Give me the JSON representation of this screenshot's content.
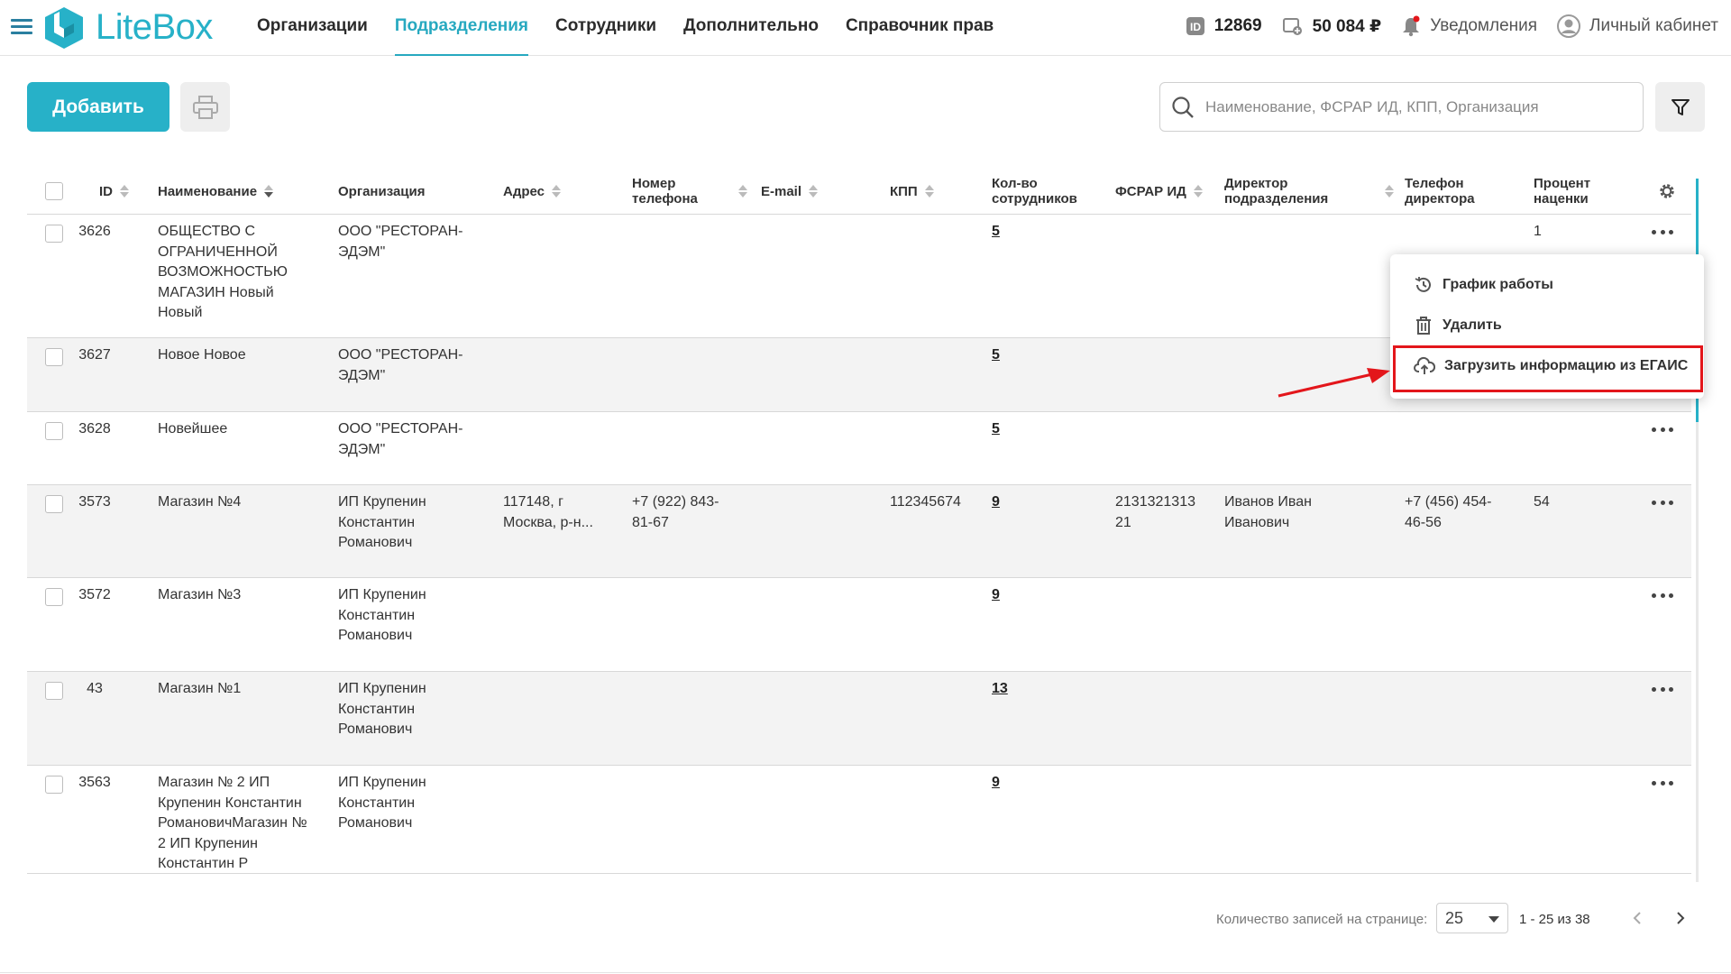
{
  "header": {
    "logo_text": "LiteBox",
    "nav": [
      "Организации",
      "Подразделения",
      "Сотрудники",
      "Дополнительно",
      "Справочник прав"
    ],
    "active_nav": "Подразделения",
    "id_value": "12869",
    "balance": "50 084 ₽",
    "notifications_label": "Уведомления",
    "account_label": "Личный кабинет"
  },
  "toolbar": {
    "add_label": "Добавить",
    "search_placeholder": "Наименование, ФСРАР ИД, КПП, Организация"
  },
  "table": {
    "columns": [
      "ID",
      "Наименование",
      "Организация",
      "Адрес",
      "Номер телефона",
      "E-mail",
      "КПП",
      "Кол-во сотрудников",
      "ФСРАР ИД",
      "Директор подразделения",
      "Телефон директора",
      "Процент наценки"
    ],
    "rows": [
      {
        "id": "3626",
        "name": [
          "ОБЩЕСТВО С",
          "ОГРАНИЧЕННОЙ",
          "ВОЗМОЖНОСТЬЮ",
          "МАГАЗИН Новый",
          "Новый"
        ],
        "org": [
          "ООО \"РЕСТОРАН-",
          "ЭДЭМ\""
        ],
        "address": [],
        "phone": [],
        "email": "",
        "kpp": "",
        "staff": "5",
        "fsrar": [],
        "director": [],
        "dir_phone": [],
        "markup": "1"
      },
      {
        "id": "3627",
        "name": [
          "Новое Новое"
        ],
        "org": [
          "ООО \"РЕСТОРАН-",
          "ЭДЭМ\""
        ],
        "address": [],
        "phone": [],
        "email": "",
        "kpp": "",
        "staff": "5",
        "fsrar": [],
        "director": [],
        "dir_phone": [],
        "markup": ""
      },
      {
        "id": "3628",
        "name": [
          "Новейшее"
        ],
        "org": [
          "ООО \"РЕСТОРАН-",
          "ЭДЭМ\""
        ],
        "address": [],
        "phone": [],
        "email": "",
        "kpp": "",
        "staff": "5",
        "fsrar": [],
        "director": [],
        "dir_phone": [],
        "markup": ""
      },
      {
        "id": "3573",
        "name": [
          "Магазин №4"
        ],
        "org": [
          "ИП Крупенин",
          "Константин",
          "Романович"
        ],
        "address": [
          "117148, г",
          "Москва, р-н..."
        ],
        "phone": [
          "+7 (922) 843-",
          "81-67"
        ],
        "email": "",
        "kpp": "112345674",
        "staff": "9",
        "fsrar": [
          "2131321313",
          "21"
        ],
        "director": [
          "Иванов Иван",
          "Иванович"
        ],
        "dir_phone": [
          "+7 (456) 454-",
          "46-56"
        ],
        "markup": "54"
      },
      {
        "id": "3572",
        "name": [
          "Магазин №3"
        ],
        "org": [
          "ИП Крупенин",
          "Константин",
          "Романович"
        ],
        "address": [],
        "phone": [],
        "email": "",
        "kpp": "",
        "staff": "9",
        "fsrar": [],
        "director": [],
        "dir_phone": [],
        "markup": ""
      },
      {
        "id": "43",
        "name": [
          "Магазин №1"
        ],
        "org": [
          "ИП Крупенин",
          "Константин",
          "Романович"
        ],
        "address": [],
        "phone": [],
        "email": "",
        "kpp": "",
        "staff": "13",
        "fsrar": [],
        "director": [],
        "dir_phone": [],
        "markup": ""
      },
      {
        "id": "3563",
        "name": [
          "Магазин № 2 ИП",
          "Крупенин Константин",
          "РомановичМагазин №",
          "2 ИП Крупенин",
          "Константин Р"
        ],
        "org": [
          "ИП Крупенин",
          "Константин",
          "Романович"
        ],
        "address": [],
        "phone": [],
        "email": "",
        "kpp": "",
        "staff": "9",
        "fsrar": [],
        "director": [],
        "dir_phone": [],
        "markup": ""
      }
    ]
  },
  "context_menu": {
    "items": [
      "График работы",
      "Удалить",
      "Загрузить информацию из ЕГАИС"
    ]
  },
  "footer": {
    "per_page_label": "Количество записей на странице:",
    "per_page_value": "25",
    "range": "1 - 25 из 38"
  },
  "colors": {
    "accent": "#27b1c8",
    "highlight": "#e3161b"
  }
}
